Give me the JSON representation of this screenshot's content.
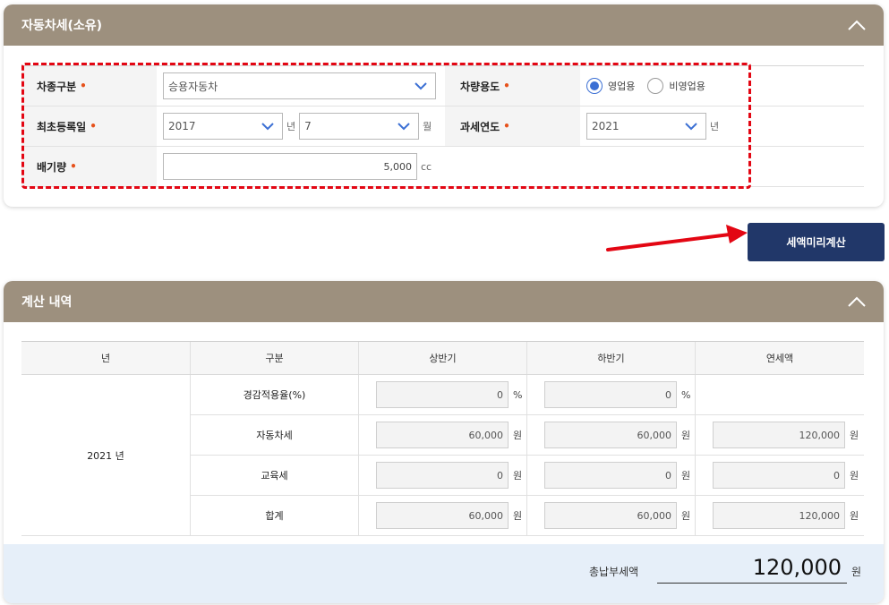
{
  "section1": {
    "title": "자동차세(소유)",
    "vehicle_type": {
      "label": "차종구분",
      "value": "승용자동차"
    },
    "vehicle_use": {
      "label": "차량용도",
      "options": [
        "영업용",
        "비영업용"
      ],
      "selected": "영업용"
    },
    "registration": {
      "label": "최초등록일",
      "year": "2017",
      "year_unit": "년",
      "month": "7",
      "month_unit": "월"
    },
    "tax_year": {
      "label": "과세연도",
      "value": "2021",
      "unit": "년"
    },
    "displacement": {
      "label": "배기량",
      "value": "5,000",
      "unit": "cc"
    },
    "required_mark": "•"
  },
  "calc_button": {
    "label": "세액미리계산"
  },
  "section2": {
    "title": "계산 내역",
    "headers": [
      "년",
      "구분",
      "상반기",
      "하반기",
      "연세액"
    ],
    "year": "2021 년",
    "rows": [
      {
        "label": "경감적용율(%)",
        "h1": "0",
        "h1_unit": "%",
        "h2": "0",
        "h2_unit": "%",
        "annual": "",
        "annual_unit": ""
      },
      {
        "label": "자동차세",
        "h1": "60,000",
        "h1_unit": "원",
        "h2": "60,000",
        "h2_unit": "원",
        "annual": "120,000",
        "annual_unit": "원"
      },
      {
        "label": "교육세",
        "h1": "0",
        "h1_unit": "원",
        "h2": "0",
        "h2_unit": "원",
        "annual": "0",
        "annual_unit": "원"
      },
      {
        "label": "합계",
        "h1": "60,000",
        "h1_unit": "원",
        "h2": "60,000",
        "h2_unit": "원",
        "annual": "120,000",
        "annual_unit": "원"
      }
    ],
    "total": {
      "label": "총납부세액",
      "value": "120,000",
      "unit": "원"
    }
  },
  "colors": {
    "header": "#9d907e",
    "button": "#213769",
    "highlight": "#e30613",
    "radio": "#3b6fd4",
    "total_bg": "#e6eff9"
  }
}
